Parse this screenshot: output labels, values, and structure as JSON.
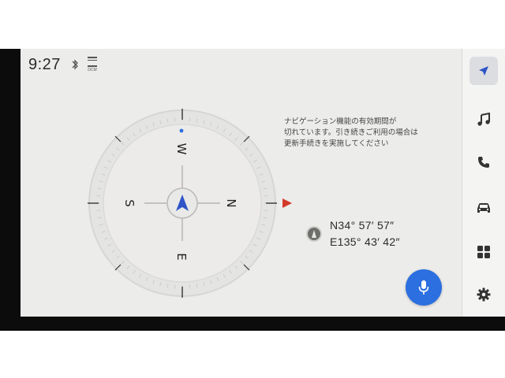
{
  "status": {
    "time": "9:27",
    "dcm_label": "DCM"
  },
  "compass": {
    "directions": {
      "top": "W",
      "right": "N",
      "bottom": "E",
      "left": "S"
    }
  },
  "message": {
    "lines": [
      "ナビゲーション機能の有効期間が",
      "切れています。引き続きご利用の場合は",
      "更新手続きを実施してください"
    ]
  },
  "coordinates": {
    "latitude": "N34° 57′ 57″",
    "longitude": "E135° 43′ 42″"
  },
  "rail": {
    "items": [
      "navigation-icon",
      "music-icon",
      "phone-icon",
      "car-icon",
      "apps-icon",
      "settings-icon"
    ]
  },
  "colors": {
    "accent": "#2b6fe0",
    "heading_arrow": "#2f56c8",
    "north_marker": "#d23a2a",
    "screen_bg": "#ececeb"
  }
}
